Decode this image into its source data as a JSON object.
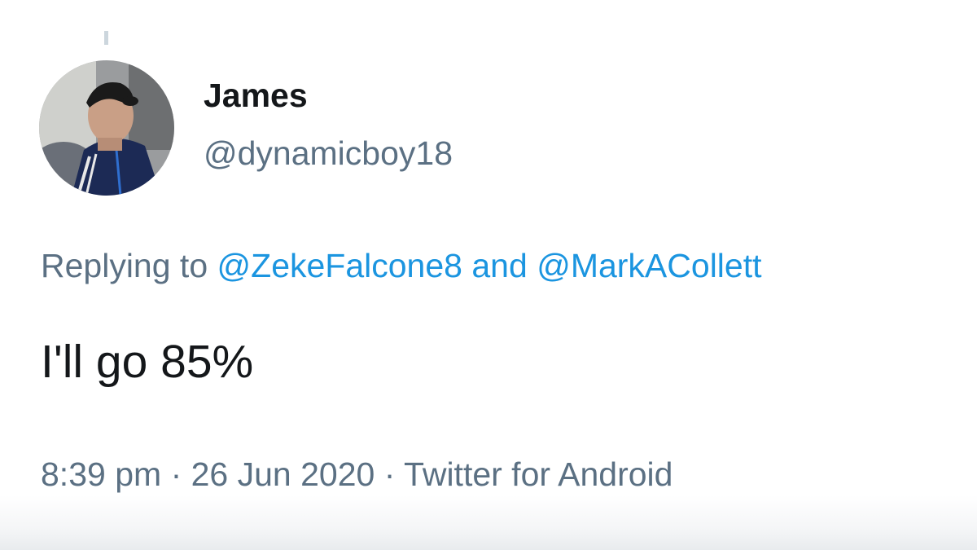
{
  "author": {
    "display_name": "James",
    "handle": "@dynamicboy18"
  },
  "reply": {
    "prefix": "Replying to",
    "mention_1": "@ZekeFalcone8",
    "connector": "and",
    "mention_2": "@MarkACollett"
  },
  "tweet": {
    "text": "I'll go 85%"
  },
  "meta": {
    "time": "8:39 pm",
    "separator": "·",
    "date": "26 Jun 2020",
    "source": "Twitter for Android"
  },
  "colors": {
    "link_blue": "#1b95e0",
    "secondary_gray": "#5b7083",
    "primary_text": "#14171a"
  },
  "icons": {
    "avatar": "user-photo-avatar"
  }
}
